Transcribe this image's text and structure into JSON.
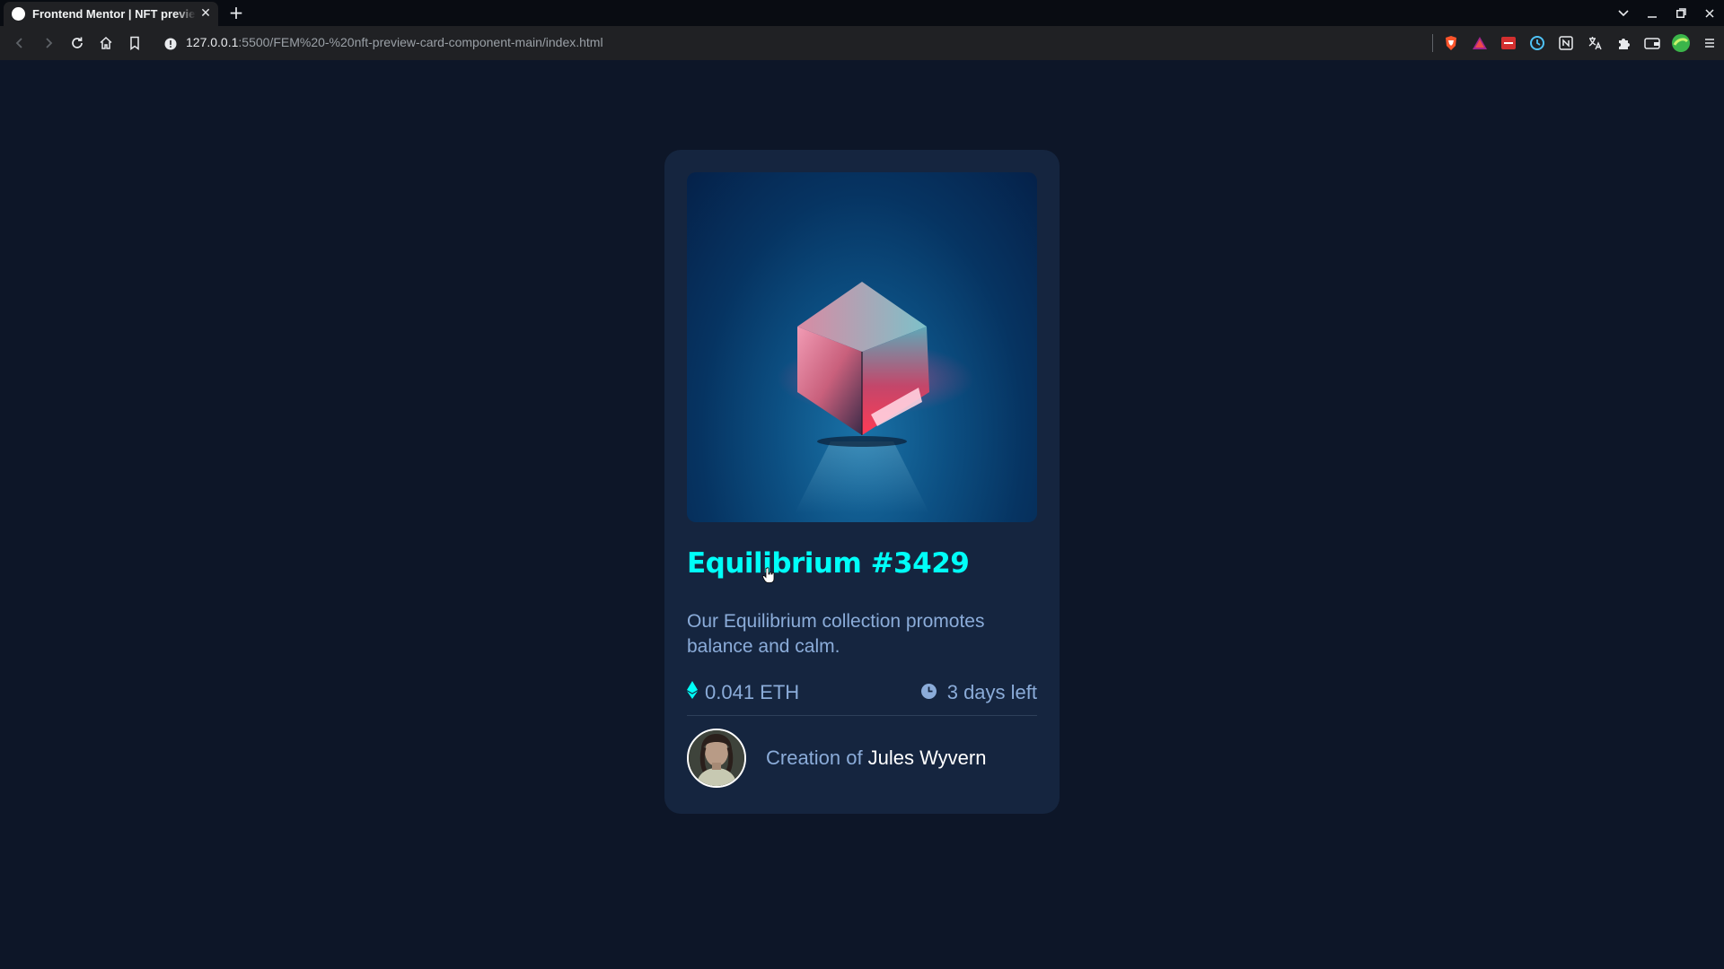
{
  "browser": {
    "tab_title": "Frontend Mentor | NFT preview card component",
    "url_host": "127.0.0.1",
    "url_rest": ":5500/FEM%20-%20nft-preview-card-component-main/index.html"
  },
  "card": {
    "title": "Equilibrium #3429",
    "description": "Our Equilibrium collection promotes balance and calm.",
    "price": "0.041 ETH",
    "time_left": "3 days left",
    "creator_prefix": "Creation of",
    "creator_name": "Jules Wyvern"
  },
  "colors": {
    "page_bg": "#0d1628",
    "card_bg": "#15253f",
    "accent_cyan": "#00fff8",
    "soft_blue": "#8bacd9",
    "divider": "#2e405a"
  }
}
